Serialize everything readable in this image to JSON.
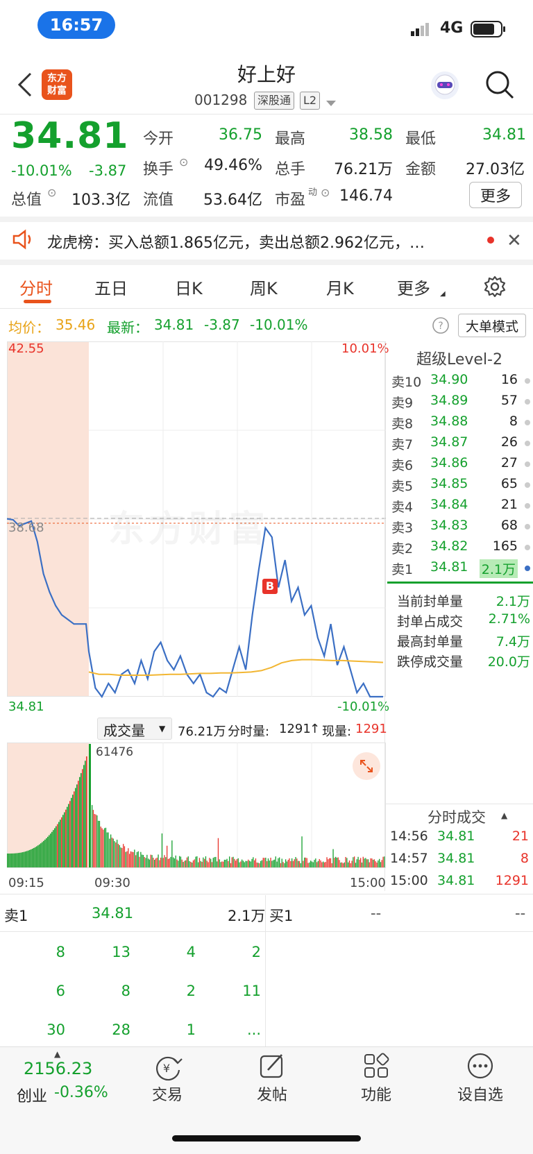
{
  "status_bar": {
    "time": "16:57",
    "network": "4G"
  },
  "header": {
    "logo_line1": "东方",
    "logo_line2": "财富",
    "stock_name": "好上好",
    "stock_code": "001298",
    "tag_connect": "深股通",
    "tag_level": "L2"
  },
  "quote": {
    "price": "34.81",
    "change_pct": "-10.01%",
    "change": "-3.87",
    "fields": {
      "open_label": "今开",
      "open": "36.75",
      "high_label": "最高",
      "high": "38.58",
      "low_label": "最低",
      "low": "34.81",
      "turnover_label": "换手",
      "turnover": "49.46%",
      "volume_label": "总手",
      "volume": "76.21万",
      "amount_label": "金额",
      "amount": "27.03亿",
      "mktcap_label": "总值",
      "mktcap": "103.3亿",
      "float_label": "流值",
      "float": "53.64亿",
      "pe_label": "市盈",
      "pe_sup": "动",
      "pe": "146.74"
    },
    "more_label": "更多"
  },
  "news": {
    "text": "龙虎榜：买入总额1.865亿元，卖出总额2.962亿元，…"
  },
  "tabs": [
    {
      "label": "分时",
      "active": true
    },
    {
      "label": "五日"
    },
    {
      "label": "日K"
    },
    {
      "label": "周K"
    },
    {
      "label": "月K"
    },
    {
      "label": "更多"
    }
  ],
  "info_line": {
    "avg_label": "均价：",
    "avg": "35.46",
    "latest_label": "最新：",
    "latest": "34.81",
    "change": "-3.87",
    "change_pct": "-10.01%",
    "big_mode": "大单模式"
  },
  "chart": {
    "y_top": "42.55",
    "y_mid": "38.68",
    "y_bottom": "34.81",
    "pct_top": "10.01%",
    "pct_bottom": "-10.01%",
    "watermark": "东方财富",
    "marker": "B",
    "colors": {
      "price": "#3b6fc4",
      "avg": "#f2b632",
      "up": "#e8332a",
      "down": "#14a02d"
    }
  },
  "chart_data": {
    "type": "line",
    "title": "",
    "x_ticks": [
      "09:15",
      "09:30",
      "15:00"
    ],
    "ylim": [
      34.81,
      42.55
    ],
    "prev_close": 38.68,
    "series": [
      {
        "values": [
          38.7,
          38.68,
          38.55,
          38.6,
          38.65,
          38.2,
          37.5,
          37.1,
          36.8,
          36.6,
          36.5,
          36.4,
          36.4,
          36.4,
          35.8,
          35.0,
          34.81,
          35.1,
          34.9,
          35.3,
          35.4,
          35.1,
          35.6,
          35.2,
          35.8,
          36.0,
          35.6,
          35.4,
          35.7,
          35.3,
          35.1,
          35.3,
          34.9,
          34.81,
          35.0,
          34.9,
          35.4,
          35.9,
          35.4,
          36.6,
          37.6,
          38.5,
          38.3,
          37.2,
          37.8,
          36.9,
          37.2,
          36.6,
          36.8,
          36.1,
          35.7,
          36.4,
          35.5,
          35.9,
          35.4,
          34.9,
          35.1,
          34.81,
          34.81,
          34.81
        ]
      },
      {
        "values": [
          35.35,
          35.3,
          35.3,
          35.28,
          35.28,
          35.28,
          35.28,
          35.29,
          35.3,
          35.3,
          35.31,
          35.32,
          35.32,
          35.33,
          35.33,
          35.34,
          35.35,
          35.38,
          35.45,
          35.55,
          35.6,
          35.62,
          35.62,
          35.61,
          35.6,
          35.6,
          35.59,
          35.58,
          35.57,
          35.56
        ]
      }
    ],
    "volume_label": "成交量",
    "total_volume": "76.21万",
    "minute_volume": "1291",
    "current_volume": "1291",
    "volume_peak": "61476"
  },
  "level2": {
    "title": "超级Level-2",
    "asks": [
      {
        "label": "卖10",
        "price": "34.90",
        "vol": "16"
      },
      {
        "label": "卖9",
        "price": "34.89",
        "vol": "57"
      },
      {
        "label": "卖8",
        "price": "34.88",
        "vol": "8"
      },
      {
        "label": "卖7",
        "price": "34.87",
        "vol": "26"
      },
      {
        "label": "卖6",
        "price": "34.86",
        "vol": "27"
      },
      {
        "label": "卖5",
        "price": "34.85",
        "vol": "65"
      },
      {
        "label": "卖4",
        "price": "34.84",
        "vol": "21"
      },
      {
        "label": "卖3",
        "price": "34.83",
        "vol": "68"
      },
      {
        "label": "卖2",
        "price": "34.82",
        "vol": "165"
      },
      {
        "label": "卖1",
        "price": "34.81",
        "vol": "2.1万"
      }
    ],
    "seal": [
      {
        "label": "当前封单量",
        "value": "2.1万"
      },
      {
        "label": "封单占成交",
        "value": "2.71%"
      },
      {
        "label": "最高封单量",
        "value": "7.4万"
      },
      {
        "label": "跌停成交量",
        "value": "20.0万"
      }
    ]
  },
  "volume_bar": {
    "label": "成交量",
    "total": "76.21万",
    "minute_label": "分时量:",
    "minute": "1291",
    "now_label": "现量:",
    "now": "1291"
  },
  "x_axis": {
    "start": "09:15",
    "open": "09:30",
    "end": "15:00"
  },
  "trades": {
    "title": "分时成交",
    "rows": [
      {
        "time": "14:56",
        "price": "34.81",
        "vol": "21"
      },
      {
        "time": "14:57",
        "price": "34.81",
        "vol": "8"
      },
      {
        "time": "15:00",
        "price": "34.81",
        "vol": "1291"
      }
    ]
  },
  "book": {
    "sell1_label": "卖1",
    "sell1_price": "34.81",
    "sell1_vol": "2.1万",
    "buy1_label": "买1",
    "buy1_price": "--",
    "buy1_vol": "--",
    "queue": [
      [
        "8",
        "13",
        "4",
        "2"
      ],
      [
        "6",
        "8",
        "2",
        "11"
      ],
      [
        "30",
        "28",
        "1",
        "..."
      ]
    ]
  },
  "bottom_nav": {
    "index_value": "2156.23",
    "index_name": "创业",
    "index_change": "-0.36%",
    "items": [
      {
        "label": "交易",
        "icon": "yen-swap-icon"
      },
      {
        "label": "发帖",
        "icon": "edit-icon"
      },
      {
        "label": "功能",
        "icon": "grid-icon"
      },
      {
        "label": "设自选",
        "icon": "more-dots-icon"
      }
    ]
  }
}
